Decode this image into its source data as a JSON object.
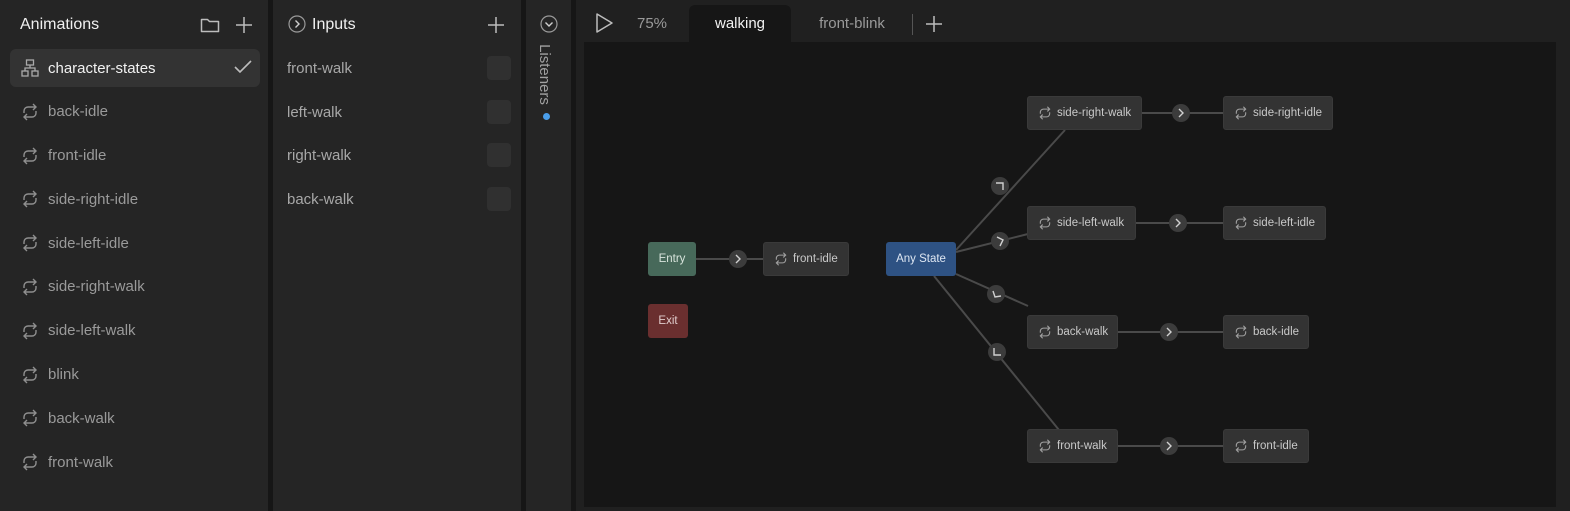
{
  "animations": {
    "title": "Animations",
    "items": [
      {
        "label": "character-states",
        "icon": "state-machine-icon",
        "selected": true
      },
      {
        "label": "back-idle",
        "icon": "loop-icon"
      },
      {
        "label": "front-idle",
        "icon": "loop-icon"
      },
      {
        "label": "side-right-idle",
        "icon": "loop-icon"
      },
      {
        "label": "side-left-idle",
        "icon": "loop-icon"
      },
      {
        "label": "side-right-walk",
        "icon": "loop-icon"
      },
      {
        "label": "side-left-walk",
        "icon": "loop-icon"
      },
      {
        "label": "blink",
        "icon": "loop-icon"
      },
      {
        "label": "back-walk",
        "icon": "loop-icon"
      },
      {
        "label": "front-walk",
        "icon": "loop-icon"
      }
    ]
  },
  "inputs": {
    "title": "Inputs",
    "items": [
      {
        "label": "front-walk"
      },
      {
        "label": "left-walk"
      },
      {
        "label": "right-walk"
      },
      {
        "label": "back-walk"
      }
    ]
  },
  "listeners": {
    "label": "Listeners",
    "dot_color": "#4a9eea"
  },
  "editor": {
    "zoom": "75%",
    "tabs": [
      {
        "label": "walking",
        "active": true
      },
      {
        "label": "front-blink",
        "active": false
      }
    ]
  },
  "graph": {
    "nodes": {
      "entry": "Entry",
      "exit": "Exit",
      "any_state": "Any State",
      "front_idle_main": "front-idle",
      "side_right_walk": "side-right-walk",
      "side_right_idle": "side-right-idle",
      "side_left_walk": "side-left-walk",
      "side_left_idle": "side-left-idle",
      "back_walk": "back-walk",
      "back_idle": "back-idle",
      "front_walk": "front-walk",
      "front_idle": "front-idle"
    }
  },
  "colors": {
    "entry": "#47695a",
    "exit": "#6a2f2f",
    "any_state": "#2e5283",
    "accent_dot": "#4a9eea"
  }
}
